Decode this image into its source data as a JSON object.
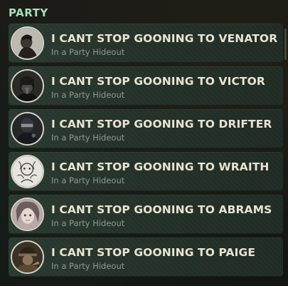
{
  "header": {
    "title": "PARTY"
  },
  "members": [
    {
      "name": "I CANT STOP GOONING TO VENATOR",
      "status": "In a Party Hideout",
      "avatar": "venator-portrait-icon"
    },
    {
      "name": "I CANT STOP GOONING TO VICTOR",
      "status": "In a Party Hideout",
      "avatar": "victor-portrait-icon"
    },
    {
      "name": "I CANT STOP GOONING TO DRIFTER",
      "status": "In a Party Hideout",
      "avatar": "drifter-portrait-icon"
    },
    {
      "name": "I CANT STOP GOONING TO WRAITH",
      "status": "In a Party Hideout",
      "avatar": "wraith-portrait-icon"
    },
    {
      "name": "I CANT STOP GOONING TO ABRAMS",
      "status": "In a Party Hideout",
      "avatar": "abrams-portrait-icon"
    },
    {
      "name": "I CANT STOP GOONING TO PAIGE",
      "status": "In a Party Hideout",
      "avatar": "paige-portrait-icon"
    }
  ],
  "colors": {
    "header": "#a9ddb5",
    "name": "#e9e3d2",
    "status": "#8e9a8f",
    "row": "#2a3a30"
  }
}
